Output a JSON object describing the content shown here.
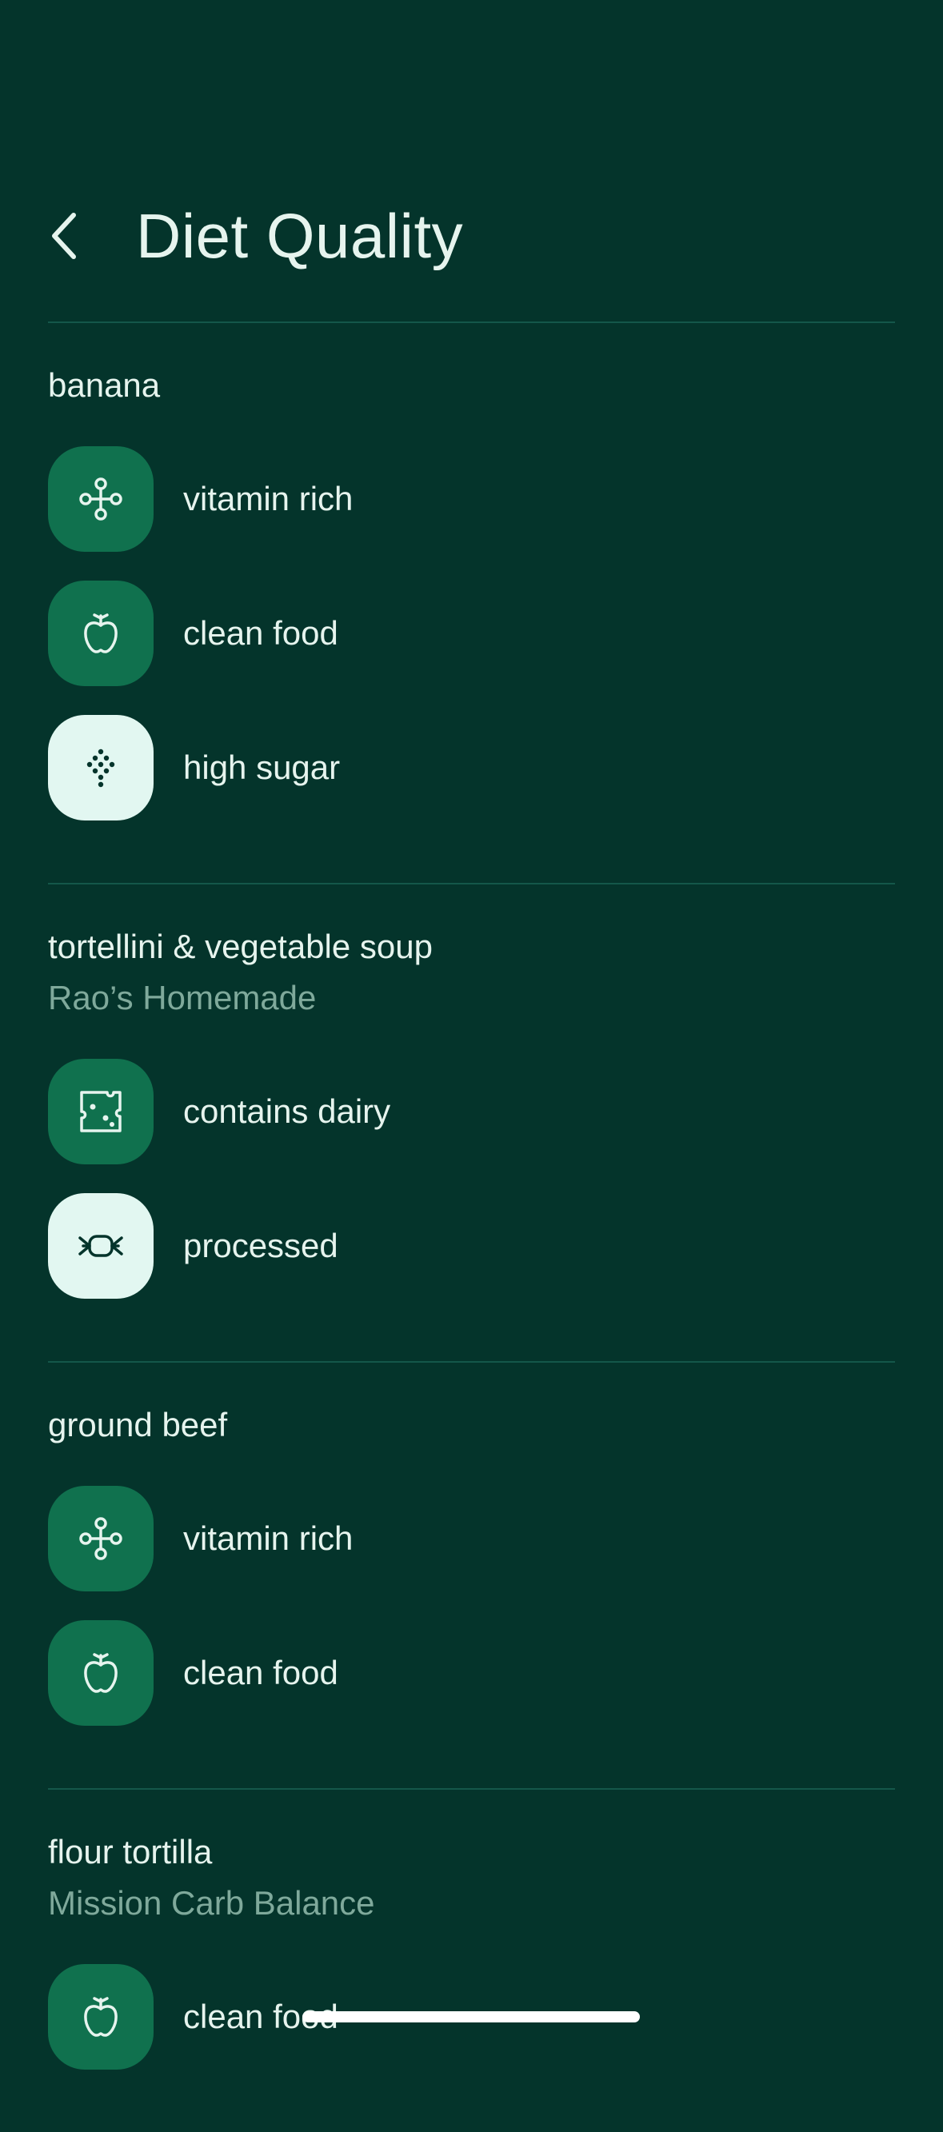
{
  "header": {
    "title": "Diet Quality",
    "back_icon": "chevron-left-icon"
  },
  "colors": {
    "background": "#04342B",
    "positive_tag_bg": "#10714E",
    "negative_tag_bg": "#E2F7F1",
    "text_primary": "#E6F4EE",
    "text_secondary": "#7FA99B",
    "divider": "#14574A"
  },
  "foods": [
    {
      "name": "banana",
      "brand": "",
      "tags": [
        {
          "label": "vitamin rich",
          "icon": "molecule-icon",
          "kind": "positive"
        },
        {
          "label": "clean food",
          "icon": "apple-icon",
          "kind": "positive"
        },
        {
          "label": "high sugar",
          "icon": "sugar-dots-icon",
          "kind": "negative"
        }
      ]
    },
    {
      "name": "tortellini & vegetable soup",
      "brand": "Rao’s Homemade",
      "tags": [
        {
          "label": "contains dairy",
          "icon": "cheese-icon",
          "kind": "positive"
        },
        {
          "label": "processed",
          "icon": "candy-icon",
          "kind": "negative"
        }
      ]
    },
    {
      "name": "ground beef",
      "brand": "",
      "tags": [
        {
          "label": "vitamin rich",
          "icon": "molecule-icon",
          "kind": "positive"
        },
        {
          "label": "clean food",
          "icon": "apple-icon",
          "kind": "positive"
        }
      ]
    },
    {
      "name": "flour tortilla",
      "brand": "Mission Carb Balance",
      "tags": [
        {
          "label": "clean food",
          "icon": "apple-icon",
          "kind": "positive"
        }
      ]
    }
  ]
}
